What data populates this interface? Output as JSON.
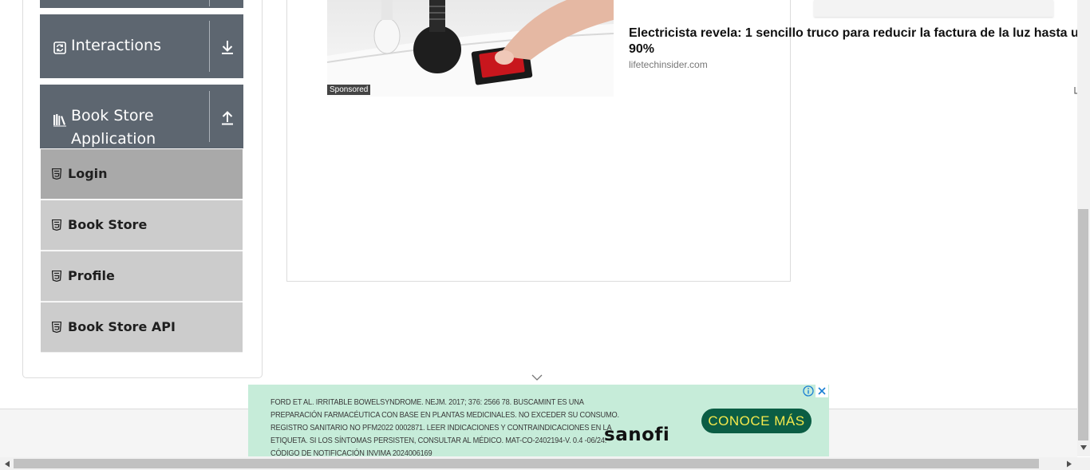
{
  "sidebar": {
    "groups": [
      {
        "title": "Interactions",
        "icon": "refresh-icon",
        "state": "collapsed"
      },
      {
        "title_line1": "Book Store",
        "title_line2": "Application",
        "icon": "books-icon",
        "state": "expanded"
      }
    ],
    "items": [
      {
        "label": "Login",
        "active": true
      },
      {
        "label": "Book Store",
        "active": false
      },
      {
        "label": "Profile",
        "active": false
      },
      {
        "label": "Book Store API",
        "active": false
      }
    ]
  },
  "ad": {
    "sponsored": "Sponsored",
    "headline": "Electricista revela: 1 sencillo truco para reducir la factura de la luz hasta u 90%",
    "domain": "lifetechinsider.com"
  },
  "bottom_ad": {
    "disclaimer": "FORD ET AL. IRRITABLE BOWELSYNDROME. NEJM. 2017; 376: 2566 78. BUSCAMINT ES UNA PREPARACIÓN FARMACÉUTICA CON BASE EN PLANTAS MEDICINALES. NO EXCEDER SU CONSUMO. REGISTRO SANITARIO NO PFM2022 0002871. LEER INDICACIONES Y CONTRAINDICACIONES EN LA ETIQUETA. SI LOS SÍNTOMAS PERSISTEN, CONSULTAR AL MÉDICO. MAT-CO-2402194-V. 0.4 -06/24. CÓDIGO DE NOTIFICACIÓN INVIMA 2024006169",
    "brand": "sanofi",
    "cta": "CONOCE MÁS"
  },
  "colors": {
    "group_header_bg": "#5d6670",
    "menu_item_bg": "#cccccc",
    "menu_item_active_bg": "#a9a9a9",
    "cta_bg": "#0b5d44",
    "cta_text": "#f5e94c",
    "bottom_ad_bg": "#c6ecd9"
  }
}
